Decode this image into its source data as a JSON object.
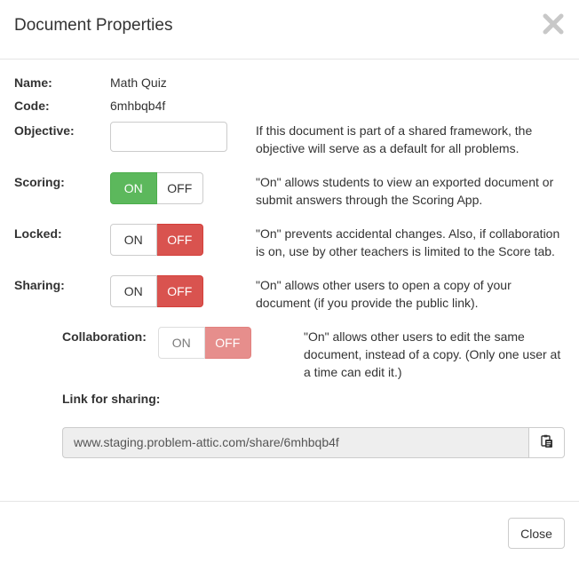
{
  "dialog": {
    "title": "Document Properties"
  },
  "fields": {
    "name": {
      "label": "Name:",
      "value": "Math Quiz"
    },
    "code": {
      "label": "Code:",
      "value": "6mhbqb4f"
    },
    "objective": {
      "label": "Objective:",
      "value": "",
      "placeholder": "",
      "help": "If this document is part of a shared framework, the objective will serve as a default for all problems."
    },
    "scoring": {
      "label": "Scoring:",
      "on": "ON",
      "off": "OFF",
      "state": "on",
      "help": "\"On\" allows students to view an exported document or submit answers through the Scoring App."
    },
    "locked": {
      "label": "Locked:",
      "on": "ON",
      "off": "OFF",
      "state": "off",
      "help": "\"On\" prevents accidental changes. Also, if collaboration is on, use by other teachers is limited to the Score tab."
    },
    "sharing": {
      "label": "Sharing:",
      "on": "ON",
      "off": "OFF",
      "state": "off",
      "help": "\"On\" allows other users to open a copy of your document (if you provide the public link)."
    },
    "collaboration": {
      "label": "Collaboration:",
      "on": "ON",
      "off": "OFF",
      "state": "off",
      "disabled": true,
      "help": "\"On\" allows other users to edit the same document, instead of a copy. (Only one user at a time can edit it.)"
    },
    "link": {
      "label": "Link for sharing:",
      "value": "www.staging.problem-attic.com/share/6mhbqb4f"
    }
  },
  "footer": {
    "close_label": "Close"
  },
  "icons": {
    "close": "close-x-icon",
    "copy": "clipboard-copy-icon"
  },
  "colors": {
    "on_active": "#5cb85c",
    "off_active": "#d9534f"
  }
}
